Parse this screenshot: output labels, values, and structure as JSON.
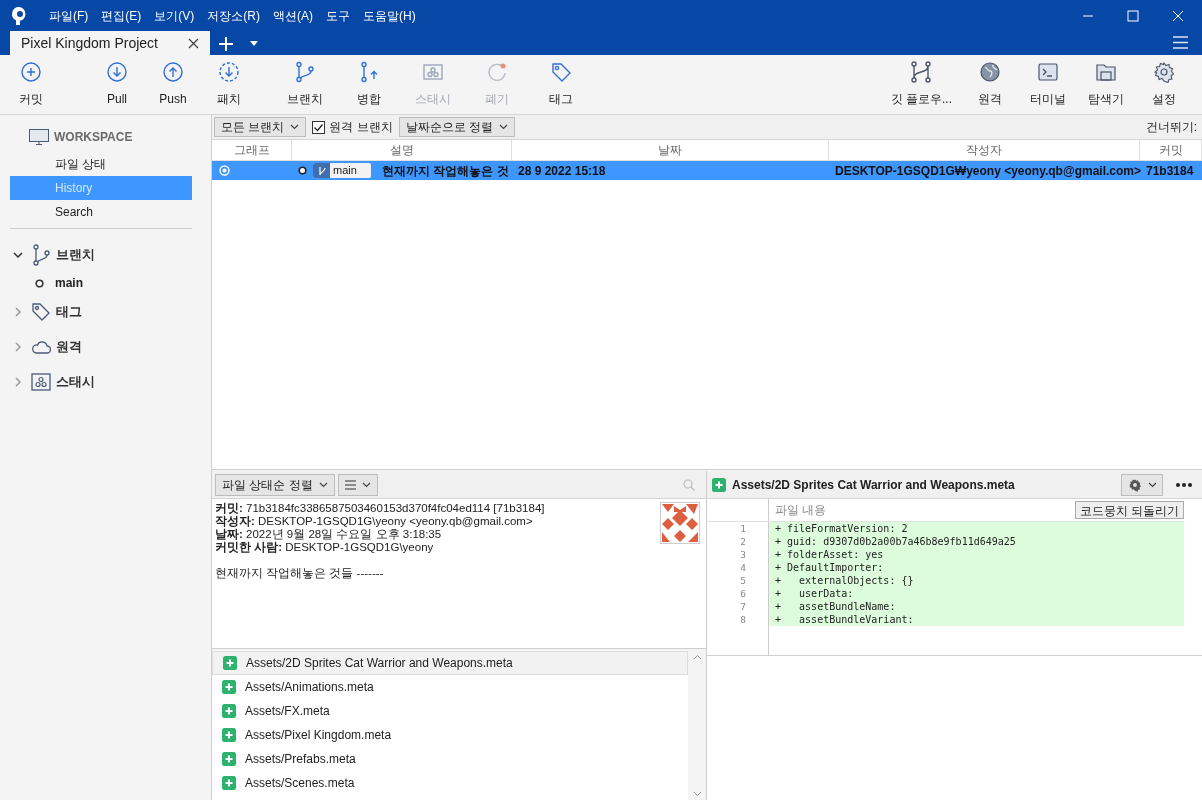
{
  "menu": [
    "파일(F)",
    "편집(E)",
    "보기(V)",
    "저장소(R)",
    "액션(A)",
    "도구",
    "도움말(H)"
  ],
  "tabs": [
    {
      "label": "Pixel Kingdom Project",
      "selected": true
    }
  ],
  "toolbar_left": [
    {
      "kind": "commit",
      "label": "커밋",
      "disabled": false
    },
    {
      "kind": "pull",
      "label": "Pull",
      "disabled": false
    },
    {
      "kind": "push",
      "label": "Push",
      "disabled": false
    },
    {
      "kind": "fetch",
      "label": "패치",
      "disabled": false
    },
    {
      "kind": "branch",
      "label": "브랜치",
      "disabled": false
    },
    {
      "kind": "merge",
      "label": "병합",
      "disabled": false
    },
    {
      "kind": "stash",
      "label": "스태시",
      "disabled": true
    },
    {
      "kind": "discard",
      "label": "폐기",
      "disabled": true
    },
    {
      "kind": "tag",
      "label": "태그",
      "disabled": false
    }
  ],
  "toolbar_right": [
    {
      "kind": "flow",
      "label": "깃 플로우...",
      "disabled": false
    },
    {
      "kind": "remote",
      "label": "원격",
      "disabled": false
    },
    {
      "kind": "terminal",
      "label": "터미널",
      "disabled": false
    },
    {
      "kind": "explorer",
      "label": "탐색기",
      "disabled": false
    },
    {
      "kind": "settings",
      "label": "설정",
      "disabled": false
    }
  ],
  "sidebar": {
    "workspace_title": "WORKSPACE",
    "workspace_items": [
      {
        "label": "파일 상태",
        "selected": false
      },
      {
        "label": "History",
        "selected": true
      },
      {
        "label": "Search",
        "selected": false
      }
    ],
    "sections": [
      {
        "kind": "branch",
        "label": "브랜치",
        "expanded": true,
        "children": [
          {
            "label": "main",
            "current": true
          }
        ]
      },
      {
        "kind": "tag",
        "label": "태그",
        "expanded": false
      },
      {
        "kind": "remote",
        "label": "원격",
        "expanded": false
      },
      {
        "kind": "stash",
        "label": "스태시",
        "expanded": false
      }
    ]
  },
  "history_toolbar": {
    "branch_filter": "모든 브랜치",
    "remote_branches": {
      "label": "원격 브랜치",
      "checked": true
    },
    "sort": "날짜순으로 정렬",
    "jump_label": "건너뛰기:"
  },
  "table": {
    "columns": [
      "그래프",
      "설명",
      "날짜",
      "작성자",
      "커밋"
    ],
    "rows": [
      {
        "selected": true,
        "branch": "main",
        "description": "현재까지 작업해놓은 것",
        "date": "28 9 2022 15:18",
        "author": "DESKTOP-1GSQD1G₩yeony <yeony.qb@gmail.com>",
        "commit": "71b3184"
      }
    ]
  },
  "details": {
    "sort": "파일 상태순 정렬",
    "lines": [
      "**커밋:** 71b3184fc3386587503460153d370f4fc04ed114 [71b3184]",
      "**작성자:** DESKTOP-1GSQD1G\\yeony <yeony.qb@gmail.com>",
      "**날짜:** 2022년 9월 28일 수요일 오후 3:18:35",
      "**커밋한 사람:** DESKTOP-1GSQD1G\\yeony"
    ],
    "message": "현재까지 작업해놓은 것들 -------"
  },
  "files": [
    {
      "path": "Assets/2D Sprites Cat Warrior and Weapons.meta",
      "selected": true
    },
    {
      "path": "Assets/Animations.meta",
      "selected": false
    },
    {
      "path": "Assets/FX.meta",
      "selected": false
    },
    {
      "path": "Assets/Pixel Kingdom.meta",
      "selected": false
    },
    {
      "path": "Assets/Prefabs.meta",
      "selected": false
    },
    {
      "path": "Assets/Scenes.meta",
      "selected": false
    }
  ],
  "diff": {
    "file": "Assets/2D Sprites Cat Warrior and Weapons.meta",
    "hunk_title": "파일 내용",
    "revert_button": "코드뭉치 되돌리기",
    "lines": [
      {
        "number": "1",
        "text": "+ fileFormatVersion: 2"
      },
      {
        "number": "2",
        "text": "+ guid: d9307d0b2a00b7a46b8e9fb11d649a25"
      },
      {
        "number": "3",
        "text": "+ folderAsset: yes"
      },
      {
        "number": "4",
        "text": "+ DefaultImporter:"
      },
      {
        "number": "5",
        "text": "+   externalObjects: {}"
      },
      {
        "number": "6",
        "text": "+   userData:"
      },
      {
        "number": "7",
        "text": "+   assetBundleName:"
      },
      {
        "number": "8",
        "text": "+   assetBundleVariant:"
      }
    ]
  }
}
